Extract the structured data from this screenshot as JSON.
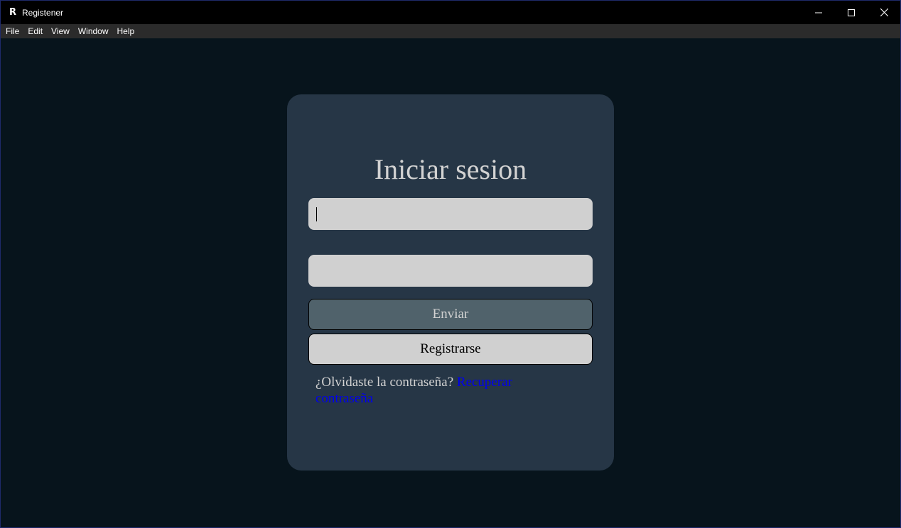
{
  "window": {
    "title": "Registener",
    "app_icon_glyph": "R",
    "controls": {
      "minimize": "—",
      "maximize": "☐",
      "close": "✕"
    }
  },
  "menubar": {
    "items": [
      "File",
      "Edit",
      "View",
      "Window",
      "Help"
    ]
  },
  "login": {
    "title": "Iniciar sesion",
    "username_value": "",
    "password_value": "",
    "send_label": "Enviar",
    "register_label": "Registrarse",
    "forgot_text": "¿Olvidaste la contraseña?",
    "recover_link": "Recuperar contraseña"
  },
  "colors": {
    "background": "#07141c",
    "card": "#263646",
    "field": "#d0d0d0",
    "send_button": "#50626b",
    "link": "#0000ee"
  }
}
